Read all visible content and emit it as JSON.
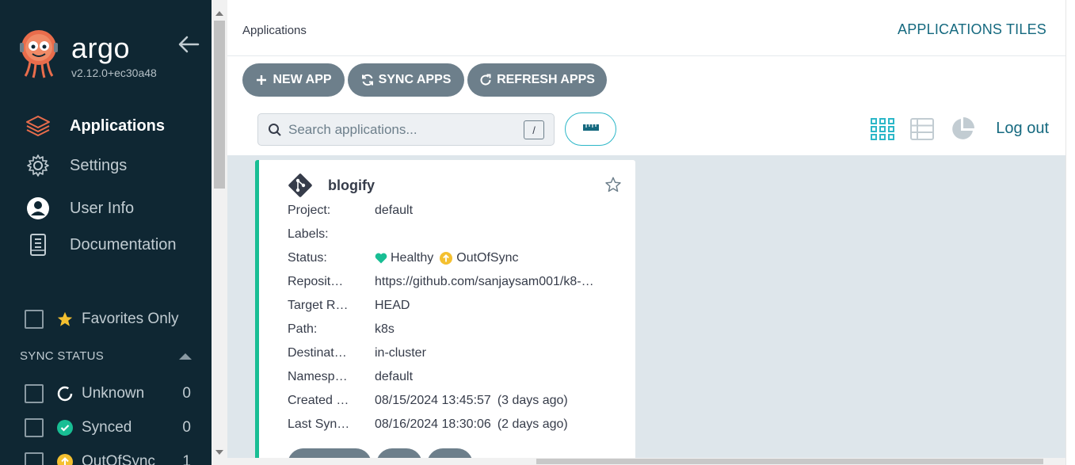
{
  "sidebar": {
    "brand": "argo",
    "version": "v2.12.0+ec30a48",
    "nav": [
      {
        "label": "Applications",
        "icon": "layers-icon",
        "active": true
      },
      {
        "label": "Settings",
        "icon": "gear-icon",
        "active": false
      },
      {
        "label": "User Info",
        "icon": "user-circle-icon",
        "active": false
      },
      {
        "label": "Documentation",
        "icon": "book-icon",
        "active": false
      }
    ],
    "favorites_label": "Favorites Only",
    "sync_status_title": "SYNC STATUS",
    "filters": [
      {
        "label": "Unknown",
        "count": "0",
        "icon": "unknown-circle-icon"
      },
      {
        "label": "Synced",
        "count": "0",
        "icon": "check-circle-icon"
      },
      {
        "label": "OutOfSync",
        "count": "1",
        "icon": "arrow-up-circle-icon"
      }
    ]
  },
  "header": {
    "breadcrumb": "Applications",
    "title": "APPLICATIONS TILES"
  },
  "toolbar": {
    "new_app": "NEW APP",
    "sync_apps": "SYNC APPS",
    "refresh_apps": "REFRESH APPS",
    "search_placeholder": "Search applications...",
    "search_shortcut": "/",
    "logout": "Log out"
  },
  "app": {
    "name": "blogify",
    "fields": [
      {
        "key": "Project:",
        "value": "default"
      },
      {
        "key": "Labels:",
        "value": ""
      },
      {
        "key": "Status:",
        "health": "Healthy",
        "sync": "OutOfSync"
      },
      {
        "key": "Reposit…",
        "value": "https://github.com/sanjaysam001/k8-…"
      },
      {
        "key": "Target R…",
        "value": "HEAD"
      },
      {
        "key": "Path:",
        "value": "k8s"
      },
      {
        "key": "Destinat…",
        "value": "in-cluster"
      },
      {
        "key": "Namesp…",
        "value": "default"
      },
      {
        "key": "Created …",
        "value": "08/15/2024 13:45:57",
        "relative": "(3 days ago)"
      },
      {
        "key": "Last Syn…",
        "value": "08/16/2024 18:30:06",
        "relative": "(2 days ago)"
      }
    ]
  },
  "colors": {
    "sidebar_bg": "#0f2733",
    "accent": "#15697f",
    "healthy": "#18be94",
    "out_of_sync": "#f4c030",
    "button_bg": "#6d7f8b",
    "content_bg": "#dee6eb"
  }
}
